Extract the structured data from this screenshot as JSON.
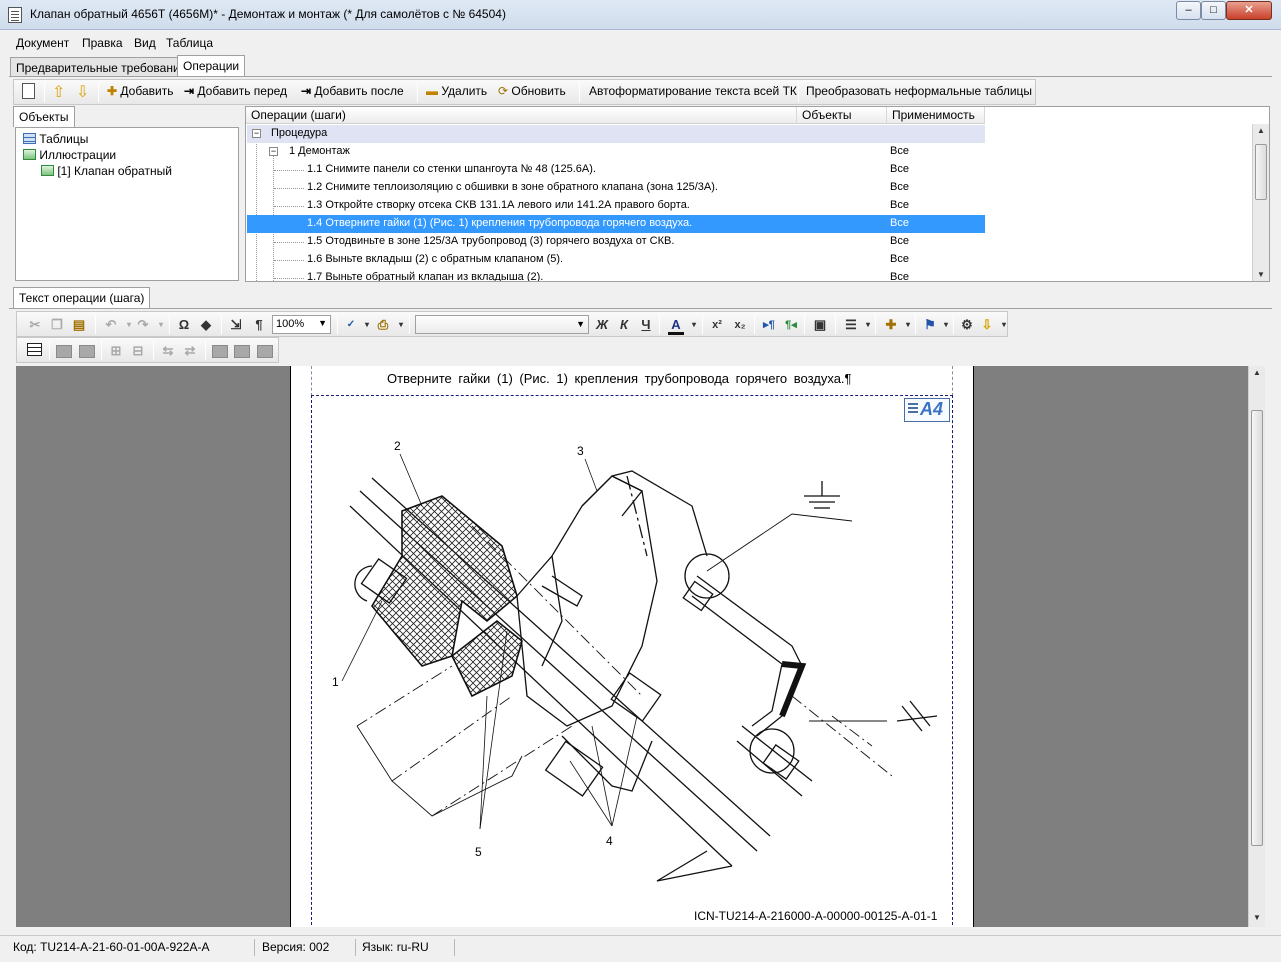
{
  "window": {
    "title": "Клапан обратный 4656Т (4656М)* - Демонтаж и монтаж (* Для самолётов с № 64504)",
    "controls": {
      "minimize": "–",
      "maximize": "□",
      "close": "✕"
    }
  },
  "menu": [
    "Документ",
    "Правка",
    "Вид",
    "Таблица"
  ],
  "top_tabs": [
    {
      "label": "Предварительные требования",
      "active": false
    },
    {
      "label": "Операции",
      "active": true
    }
  ],
  "ops_toolbar": {
    "add": "Добавить",
    "add_before": "Добавить перед",
    "add_after": "Добавить после",
    "delete": "Удалить",
    "refresh": "Обновить",
    "autoformat": "Автоформатирование текста всей ТК",
    "convert_tables": "Преобразовать неформальные таблицы"
  },
  "objects_panel": {
    "tab": "Объекты",
    "tree": [
      {
        "label": "Таблицы",
        "icon": "table-icon"
      },
      {
        "label": "Иллюстрации",
        "icon": "illustration-icon"
      },
      {
        "label": "[1] Клапан обратный",
        "icon": "illustration-icon"
      }
    ]
  },
  "ops_grid": {
    "columns": [
      "Операции (шаги)",
      "Объекты",
      "Применимость"
    ],
    "rows": [
      {
        "label": "Процедура",
        "applicability": "",
        "type": "proc"
      },
      {
        "label": "1 Демонтаж",
        "applicability": "Все",
        "type": "group"
      },
      {
        "label": "1.1 Снимите панели со стенки шпангоута № 48 (125.6А).",
        "applicability": "Все"
      },
      {
        "label": "1.2 Снимите теплоизоляцию с обшивки в зоне обратного клапана (зона 125/3А).",
        "applicability": "Все"
      },
      {
        "label": "1.3 Откройте створку отсека СКВ 131.1А левого или 141.2А правого борта.",
        "applicability": "Все"
      },
      {
        "label": "1.4 Отверните гайки (1) (Рис. 1) крепления трубопровода горячего воздуха.",
        "applicability": "Все",
        "selected": true
      },
      {
        "label": "1.5 Отодвиньте в зоне 125/3А трубопровод (3) горячего воздуха от СКВ.",
        "applicability": "Все"
      },
      {
        "label": "1.6 Выньте вкладыш (2) с обратным клапаном (5).",
        "applicability": "Все"
      },
      {
        "label": "1.7 Выньте обратный клапан из вкладыша (2).",
        "applicability": "Все"
      }
    ]
  },
  "step_text_tab": "Текст операции (шага)",
  "editor_toolbar": {
    "zoom": "100%",
    "style_value": "",
    "bold": "Ж",
    "italic": "К",
    "underline": "Ч",
    "font_color": "А",
    "superscript": "x²",
    "subscript": "x₂",
    "omega": "Ω",
    "pilcrow": "¶"
  },
  "document": {
    "step_text": "Отверните гайки (1) (Рис. 1) крепления трубопровода горячего воздуха.¶",
    "format_badge": "A4",
    "callouts": [
      "1",
      "2",
      "3",
      "4",
      "5"
    ],
    "figure_code": "ICN-TU214-A-216000-A-00000-00125-A-01-1"
  },
  "status": {
    "code": "Код: TU214-A-21-60-01-00A-922A-A",
    "version": "Версия: 002",
    "language": "Язык: ru-RU"
  }
}
